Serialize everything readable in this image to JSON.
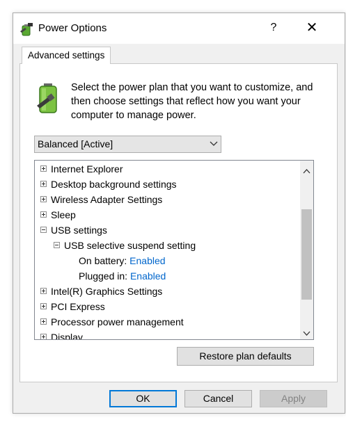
{
  "window": {
    "title": "Power Options",
    "help_glyph": "?",
    "close_glyph": "✕"
  },
  "tab": {
    "label": "Advanced settings"
  },
  "description": "Select the power plan that you want to customize, and then choose settings that reflect how you want your computer to manage power.",
  "plan_select": {
    "selected": "Balanced [Active]"
  },
  "tree": {
    "items": [
      {
        "label": "Internet Explorer",
        "expander": "+"
      },
      {
        "label": "Desktop background settings",
        "expander": "+"
      },
      {
        "label": "Wireless Adapter Settings",
        "expander": "+"
      },
      {
        "label": "Sleep",
        "expander": "+"
      },
      {
        "label": "USB settings",
        "expander": "-"
      },
      {
        "label": "USB selective suspend setting",
        "expander": "-"
      },
      {
        "label": "On battery:",
        "value": "Enabled"
      },
      {
        "label": "Plugged in:",
        "value": "Enabled"
      },
      {
        "label": "Intel(R) Graphics Settings",
        "expander": "+"
      },
      {
        "label": "PCI Express",
        "expander": "+"
      },
      {
        "label": "Processor power management",
        "expander": "+"
      },
      {
        "label": "Display",
        "expander": "+"
      }
    ]
  },
  "buttons": {
    "restore": "Restore plan defaults",
    "ok": "OK",
    "cancel": "Cancel",
    "apply": "Apply"
  },
  "colors": {
    "link": "#0066cc",
    "focus_border": "#0078d7"
  },
  "icons": {
    "app": "power-options-icon",
    "battery": "battery-plug-icon",
    "expand": "plus-box-icon",
    "collapse": "minus-box-icon",
    "dropdown": "chevron-down-icon",
    "scroll_up": "chevron-up-icon",
    "scroll_down": "chevron-down-icon"
  }
}
